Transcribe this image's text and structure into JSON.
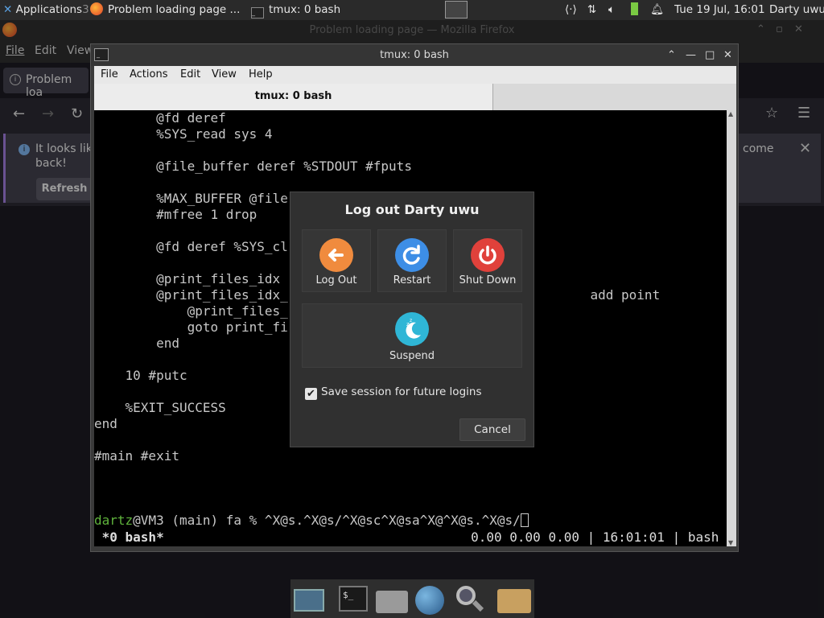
{
  "panel": {
    "applications_label": "Applications",
    "task_firefox": "Problem loading page ...",
    "task_terminal": "tmux: 0 bash",
    "clock": "Tue 19 Jul, 16:01",
    "user": "Darty uwu"
  },
  "firefox": {
    "window_title": "Problem loading page — Mozilla Firefox",
    "menu": [
      "File",
      "Edit",
      "View"
    ],
    "tab_label": "Problem loa",
    "notice_text": "It looks lik",
    "notice_text_2": "back!",
    "notice_text_right": "come",
    "refresh_button": "Refresh"
  },
  "terminal": {
    "window_title": "tmux: 0 bash",
    "menu": [
      "File",
      "Actions",
      "Edit",
      "View",
      "Help"
    ],
    "tab_label": "tmux: 0 bash",
    "lines": [
      "        @fd deref",
      "        %SYS_read sys 4",
      "",
      "        @file_buffer deref %STDOUT #fputs",
      "",
      "        %MAX_BUFFER @file",
      "        #mfree 1 drop",
      "",
      "        @fd deref %SYS_cl",
      "",
      "        @print_files_idx",
      "        @print_files_idx_                                       add point",
      "            @print_files_",
      "            goto print_fi",
      "        end",
      "",
      "    10 #putc",
      "",
      "    %EXIT_SUCCESS",
      "end",
      "",
      "#main #exit",
      "",
      "",
      ""
    ],
    "prompt_user": "dartz",
    "prompt_rest": "@VM3 (main) fa % ^X@s.^X@s/^X@sc^X@sa^X@^X@s.^X@s/",
    "status_left": " *0 bash*",
    "status_right": "0.00 0.00 0.00 | 16:01:01 | bash "
  },
  "dialog": {
    "title": "Log out Darty uwu",
    "logout_label": "Log Out",
    "restart_label": "Restart",
    "shutdown_label": "Shut Down",
    "suspend_label": "Suspend",
    "save_session_label": "Save session for future logins",
    "save_session_checked": true,
    "cancel_label": "Cancel"
  },
  "colors": {
    "logout": "#f08b3e",
    "restart": "#3d8ee6",
    "shutdown": "#e0413b",
    "suspend": "#2fb6d6",
    "prompt_user": "#5fb33c"
  }
}
